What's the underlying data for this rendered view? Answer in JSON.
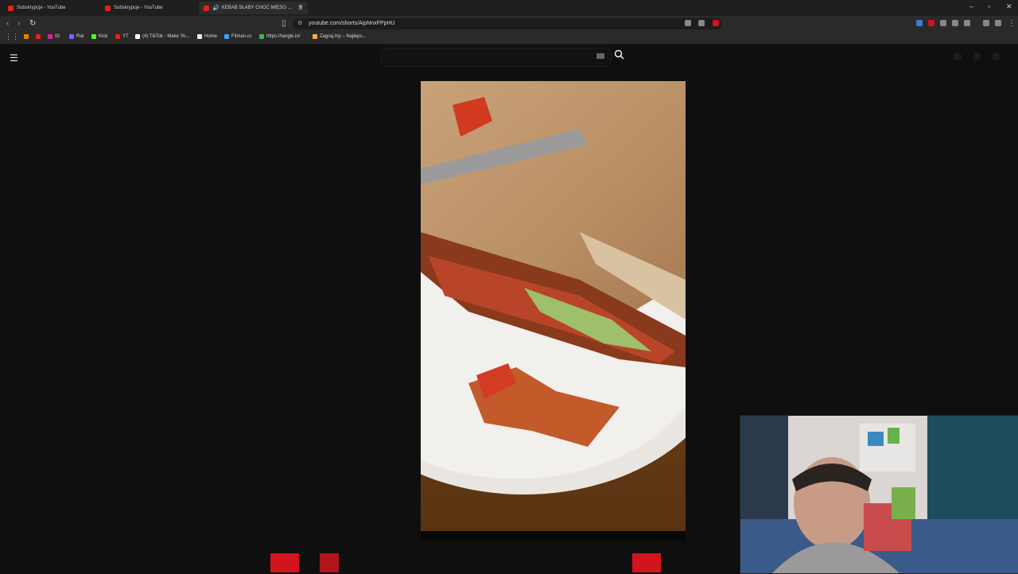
{
  "tabs": [
    {
      "label": "Subskrypcje - YouTube"
    },
    {
      "label": "Subskrypcje - YouTube"
    },
    {
      "label": "KEBAB SŁABY CHOĆ MIĘSO ..."
    }
  ],
  "address": {
    "url": "youtube.com/shorts/AipNnxFPpHU"
  },
  "bookmarks": [
    {
      "label": "IG",
      "color": "#d6249f"
    },
    {
      "label": "Rat",
      "color": "#8a5cf6"
    },
    {
      "label": "Kick",
      "color": "#53fc18"
    },
    {
      "label": "YT",
      "color": "#e62117"
    },
    {
      "label": "(4) TikTok - Make Yo...",
      "color": "#ffffff"
    },
    {
      "label": "Home",
      "color": "#ffffff"
    },
    {
      "label": "Filman.cc",
      "color": "#3aa0ff"
    },
    {
      "label": "https://tangle.io/",
      "color": "#4caf50"
    },
    {
      "label": "Zagraj.my – Najleps...",
      "color": "#f5b041"
    }
  ],
  "youtube": {
    "search_placeholder": "",
    "menu_icon": "hamburger-icon",
    "search_icon": "search-icon",
    "keyboard_icon": "keyboard-icon"
  },
  "colors": {
    "accent": "#e62117",
    "page_bg": "#0f0f0f",
    "chrome_bg": "#2a2a2a"
  }
}
